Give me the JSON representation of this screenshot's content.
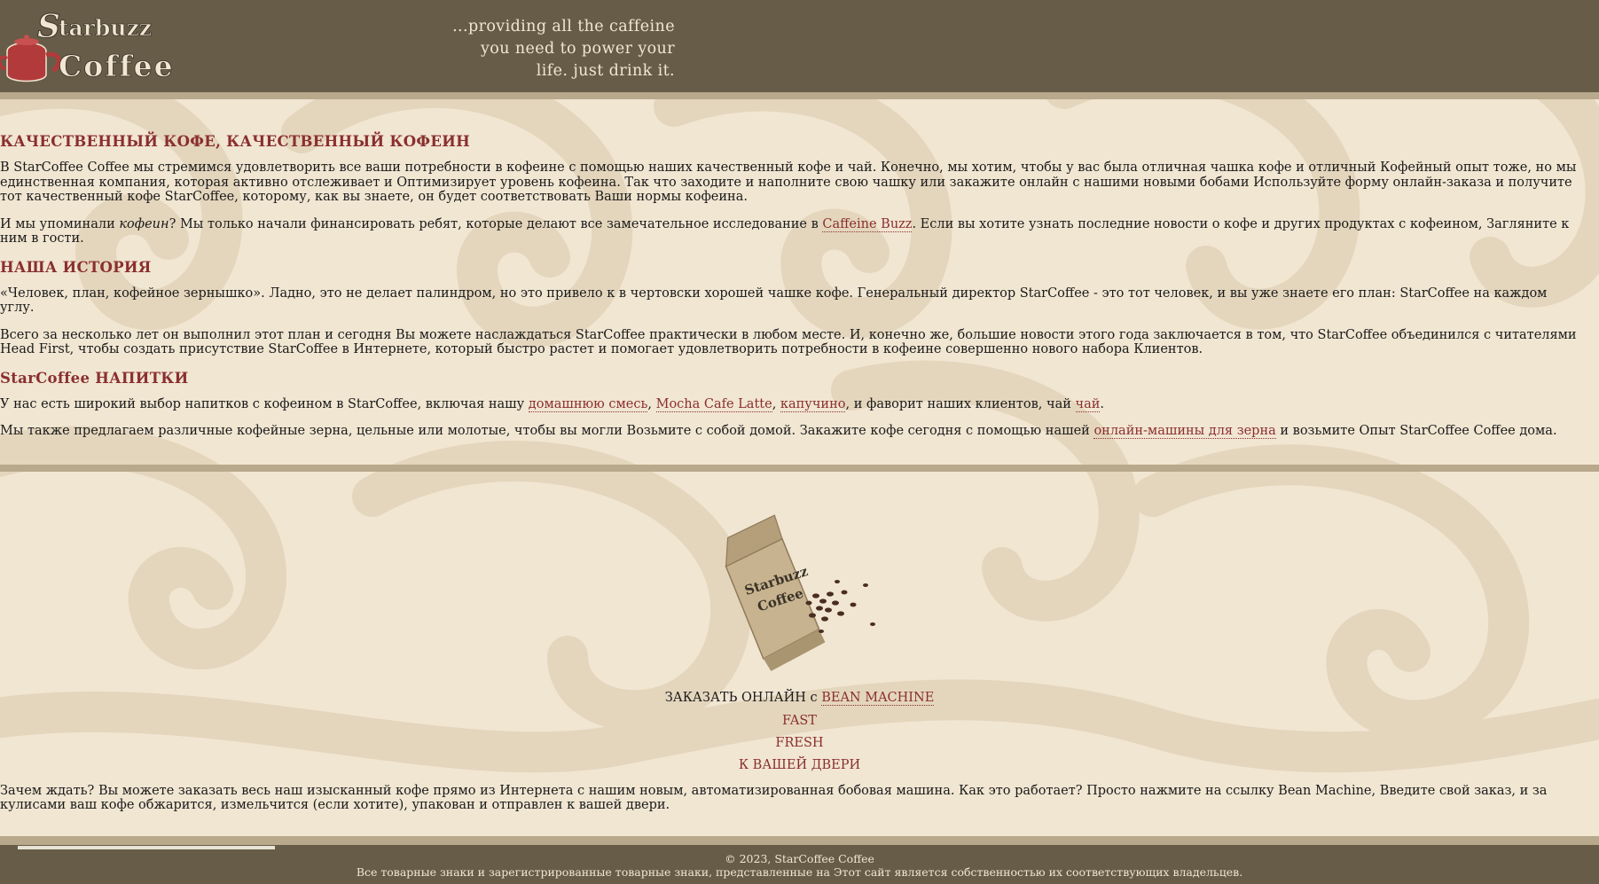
{
  "brand": {
    "logo_word1": "Starbuzz",
    "logo_word2": "Coffee",
    "slogan": [
      "...providing all the caffeine",
      "you need to power your",
      "life. just drink it."
    ]
  },
  "sections": {
    "quality": {
      "title": "КАЧЕСТВЕННЫЙ КОФЕ, КАЧЕСТВЕННЫЙ КОФЕИН",
      "p1": "В StarCoffee Coffee мы стремимся удовлетворить все ваши потребности в кофеине с помощью наших качественный кофе и чай. Конечно, мы хотим, чтобы у вас была отличная чашка кофе и отличный Кофейный опыт тоже, но мы единственная компания, которая активно отслеживает и Оптимизирует уровень кофеина. Так что заходите и наполните свою чашку или закажите онлайн с нашими новыми бобами Используйте форму онлайн-заказа и получите тот качественный кофе StarCoffee, которому, как вы знаете, он будет соответствовать Ваши нормы кофеина.",
      "p2_before": "И мы упоминали ",
      "p2_em": "кофеин",
      "p2_mid": "? Мы только начали финансировать ребят, которые делают все замечательное исследование в ",
      "p2_link": "Caffeine Buzz",
      "p2_after": ". Если вы хотите узнать последние новости о кофе и других продуктах с кофеином, Загляните к ним в гости."
    },
    "history": {
      "title": "НАША ИСТОРИЯ",
      "p1": "«Человек, план, кофейное зернышко». Ладно, это не делает палиндром, но это привело к в чертовски хорошей чашке кофе. Генеральный директор StarCoffee - это тот человек, и вы уже знаете его план: StarCoffee на каждом углу.",
      "p2": "Всего за несколько лет он выполнил этот план и сегодня Вы можете наслаждаться StarCoffee практически в любом месте. И, конечно же, большие новости этого года заключается в том, что StarCoffee объединился с читателями Head First, чтобы создать присутствие StarCoffee в Интернете, который быстро растет и помогает удовлетворить потребности в кофеине совершенно нового набора Клиентов."
    },
    "drinks": {
      "title": "StarCoffee НАПИТКИ",
      "p1_before": "У нас есть широкий выбор напитков с кофеином в StarCoffee, включая нашу ",
      "link_blend": "домашнюю смесь",
      "comma1": ", ",
      "link_mocha": "Mocha Cafe Latte",
      "comma2": ", ",
      "link_cappuccino": "капучино",
      "p1_mid": ", и фаворит наших клиентов, чай ",
      "link_tea": "чай",
      "p1_end": ".",
      "p2_before": "Мы также предлагаем различные кофейные зерна, цельные или молотые, чтобы вы могли Возьмите с собой домой. Закажите кофе сегодня с помощью нашей ",
      "p2_link": "онлайн-машины для зерна",
      "p2_after": " и возьмите Опыт StarCoffee Coffee дома."
    }
  },
  "promo": {
    "bag_label_1": "Starbuzz",
    "bag_label_2": "Coffee",
    "order_text": "ЗАКАЗАТЬ ОНЛАЙН с ",
    "order_link": "BEAN MACHINE",
    "word1": "FAST",
    "word2": "FRESH",
    "word3": "К ВАШЕЙ ДВЕРИ",
    "paragraph": "Зачем ждать? Вы можете заказать весь наш изысканный кофе прямо из Интернета с нашим новым, автоматизированная бобовая машина. Как это работает? Просто нажмите на ссылку Bean Machine, Введите свой заказ, и за кулисами ваш кофе обжарится, измельчится (если хотите), упакован и отправлен к вашей двери."
  },
  "footer": {
    "copyright": "© 2023, StarCoffee Coffee",
    "trademarks": "Все товарные знаки и зарегистрированные товарные знаки, представленные на Этот сайт является собственностью их соответствующих владельцев."
  },
  "colors": {
    "header_bg": "#675c47",
    "page_bg": "#f1e6d2",
    "accent": "#8a2f2f",
    "rule": "#b8a98c"
  }
}
